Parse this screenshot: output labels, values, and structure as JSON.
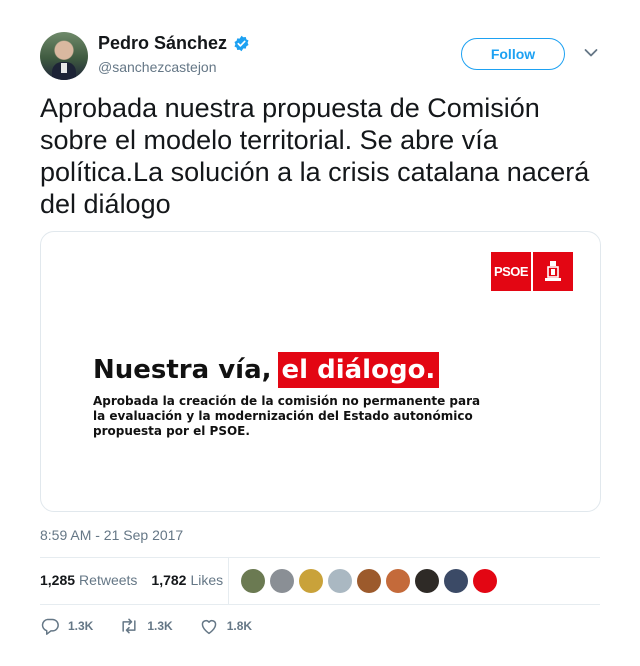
{
  "user": {
    "name": "Pedro Sánchez",
    "handle": "@sanchezcastejon",
    "verified": true
  },
  "header": {
    "follow_label": "Follow",
    "menu_icon": "chevron-down-icon"
  },
  "tweet": {
    "text": "Aprobada nuestra propuesta de Comisión sobre el modelo territorial. Se abre vía política.La solución a la crisis catalana nacerá del diálogo",
    "timestamp": "8:59 AM - 21 Sep 2017"
  },
  "card": {
    "logo_text": "PSOE",
    "headline_plain": "Nuestra vía,",
    "headline_highlight": "el diálogo.",
    "subtext": "Aprobada la creación de la comisión no permanente para la evaluación y la modernización del Estado autonómico propuesta por el PSOE."
  },
  "stats": {
    "retweets_count": "1,285",
    "retweets_label": "Retweets",
    "likes_count": "1,782",
    "likes_label": "Likes"
  },
  "likers": [
    {
      "color": "#6b7a52"
    },
    {
      "color": "#8a8f95"
    },
    {
      "color": "#c9a23a"
    },
    {
      "color": "#aab8c2"
    },
    {
      "color": "#9c5a2c"
    },
    {
      "color": "#c46a3a"
    },
    {
      "color": "#2e2a26"
    },
    {
      "color": "#3b4a66"
    },
    {
      "color": "#e30613"
    }
  ],
  "actions": {
    "replies": "1.3K",
    "retweets": "1.3K",
    "likes": "1.8K"
  },
  "colors": {
    "accent": "#1da1f2",
    "psoe_red": "#e30613",
    "muted": "#657786"
  }
}
